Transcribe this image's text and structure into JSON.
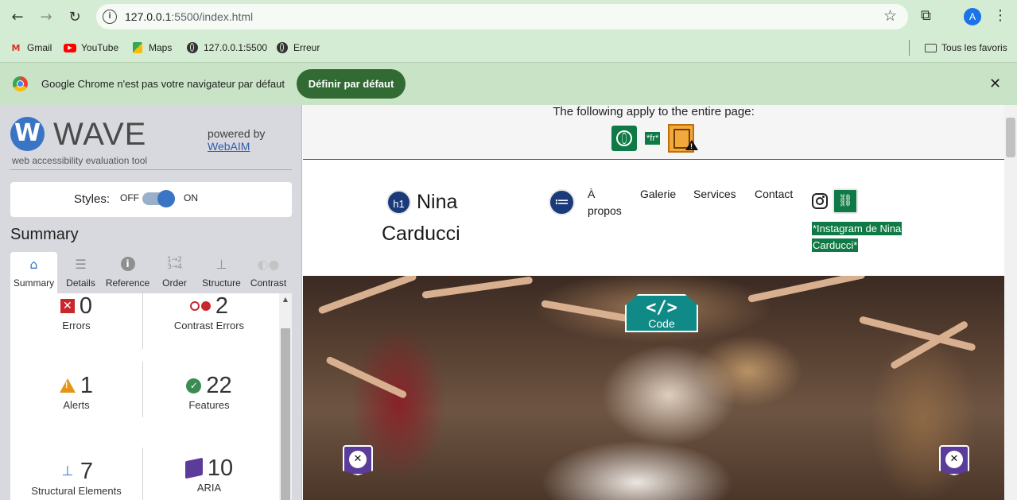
{
  "browser": {
    "url_host": "127.0.0.1",
    "url_rest": ":5500/index.html",
    "profile_initial": "A",
    "bookmarks": [
      {
        "label": "Gmail",
        "icon": "gmail-icon"
      },
      {
        "label": "YouTube",
        "icon": "youtube-icon"
      },
      {
        "label": "Maps",
        "icon": "maps-icon"
      },
      {
        "label": "127.0.0.1:5500",
        "icon": "globe-icon"
      },
      {
        "label": "Erreur",
        "icon": "globe-icon"
      }
    ],
    "all_bookmarks_label": "Tous les favoris",
    "infobar": {
      "message": "Google Chrome n'est pas votre navigateur par défaut",
      "button": "Définir par défaut"
    }
  },
  "wave": {
    "logo_letter": "W",
    "title": "WAVE",
    "tagline": "web accessibility evaluation tool",
    "powered_by": "powered by",
    "webaim": "WebAIM",
    "styles": {
      "label": "Styles:",
      "off": "OFF",
      "on": "ON",
      "state": "on"
    },
    "summary_title": "Summary",
    "tabs": [
      {
        "label": "Summary",
        "icon": "home-icon",
        "active": true
      },
      {
        "label": "Details",
        "icon": "list-icon",
        "active": false
      },
      {
        "label": "Reference",
        "icon": "info-icon",
        "active": false
      },
      {
        "label": "Order",
        "icon": "order-icon",
        "active": false
      },
      {
        "label": "Structure",
        "icon": "structure-icon",
        "active": false
      },
      {
        "label": "Contrast",
        "icon": "contrast-icon",
        "active": false
      }
    ],
    "stats": {
      "errors": {
        "count": "0",
        "label": "Errors"
      },
      "contrast_errors": {
        "count": "2",
        "label": "Contrast Errors"
      },
      "alerts": {
        "count": "1",
        "label": "Alerts"
      },
      "features": {
        "count": "22",
        "label": "Features"
      },
      "structural": {
        "count": "7",
        "label": "Structural Elements"
      },
      "aria": {
        "count": "10",
        "label": "ARIA"
      }
    }
  },
  "page": {
    "applies_text": "The following apply to the entire page:",
    "lang_badge": "*fr*",
    "h1_badge": "h1",
    "site_name": "Nina Carducci",
    "nav": [
      "À propos",
      "Galerie",
      "Services",
      "Contact"
    ],
    "instagram_label": "*Instagram de Nina Carducci*",
    "code_button": {
      "glyph": "</>",
      "label": "Code"
    }
  },
  "colors": {
    "chrome_green": "#d5ecd4",
    "infobar_button": "#326a33",
    "wave_blue": "#3a74c4",
    "error_red": "#c8282d",
    "feature_green": "#0f7a45",
    "aria_purple": "#5b3c9a",
    "code_teal": "#0f8a86"
  }
}
